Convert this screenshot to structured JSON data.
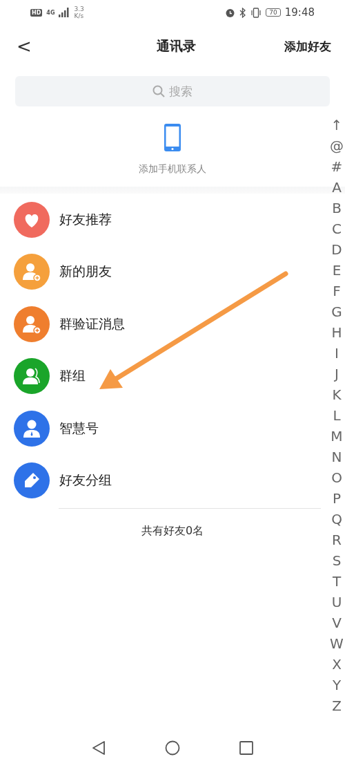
{
  "status_bar": {
    "network_badge": "HD",
    "network_type": "4G",
    "speed_value": "3.3",
    "speed_unit": "K/s",
    "battery": "70",
    "time": "19:48"
  },
  "header": {
    "back": "<",
    "title": "通讯录",
    "action": "添加好友"
  },
  "search": {
    "placeholder": "搜索"
  },
  "phone_contacts": {
    "label": "添加手机联系人"
  },
  "items": [
    {
      "label": "好友推荐",
      "kind": "heart",
      "color": "#f06a5e"
    },
    {
      "label": "新的朋友",
      "kind": "personadd",
      "color": "#f5a03c"
    },
    {
      "label": "群验证消息",
      "kind": "personadd",
      "color": "#ef7e2e"
    },
    {
      "label": "群组",
      "kind": "group",
      "color": "#1aa52a"
    },
    {
      "label": "智慧号",
      "kind": "persontie",
      "color": "#2e72e8"
    },
    {
      "label": "好友分组",
      "kind": "tag",
      "color": "#2e72e8"
    }
  ],
  "footer": "共有好友0名",
  "index": [
    "↑",
    "@",
    "#",
    "A",
    "B",
    "C",
    "D",
    "E",
    "F",
    "G",
    "H",
    "I",
    "J",
    "K",
    "L",
    "M",
    "N",
    "O",
    "P",
    "Q",
    "R",
    "S",
    "T",
    "U",
    "V",
    "W",
    "X",
    "Y",
    "Z"
  ],
  "annotation": {
    "kind": "arrow"
  }
}
